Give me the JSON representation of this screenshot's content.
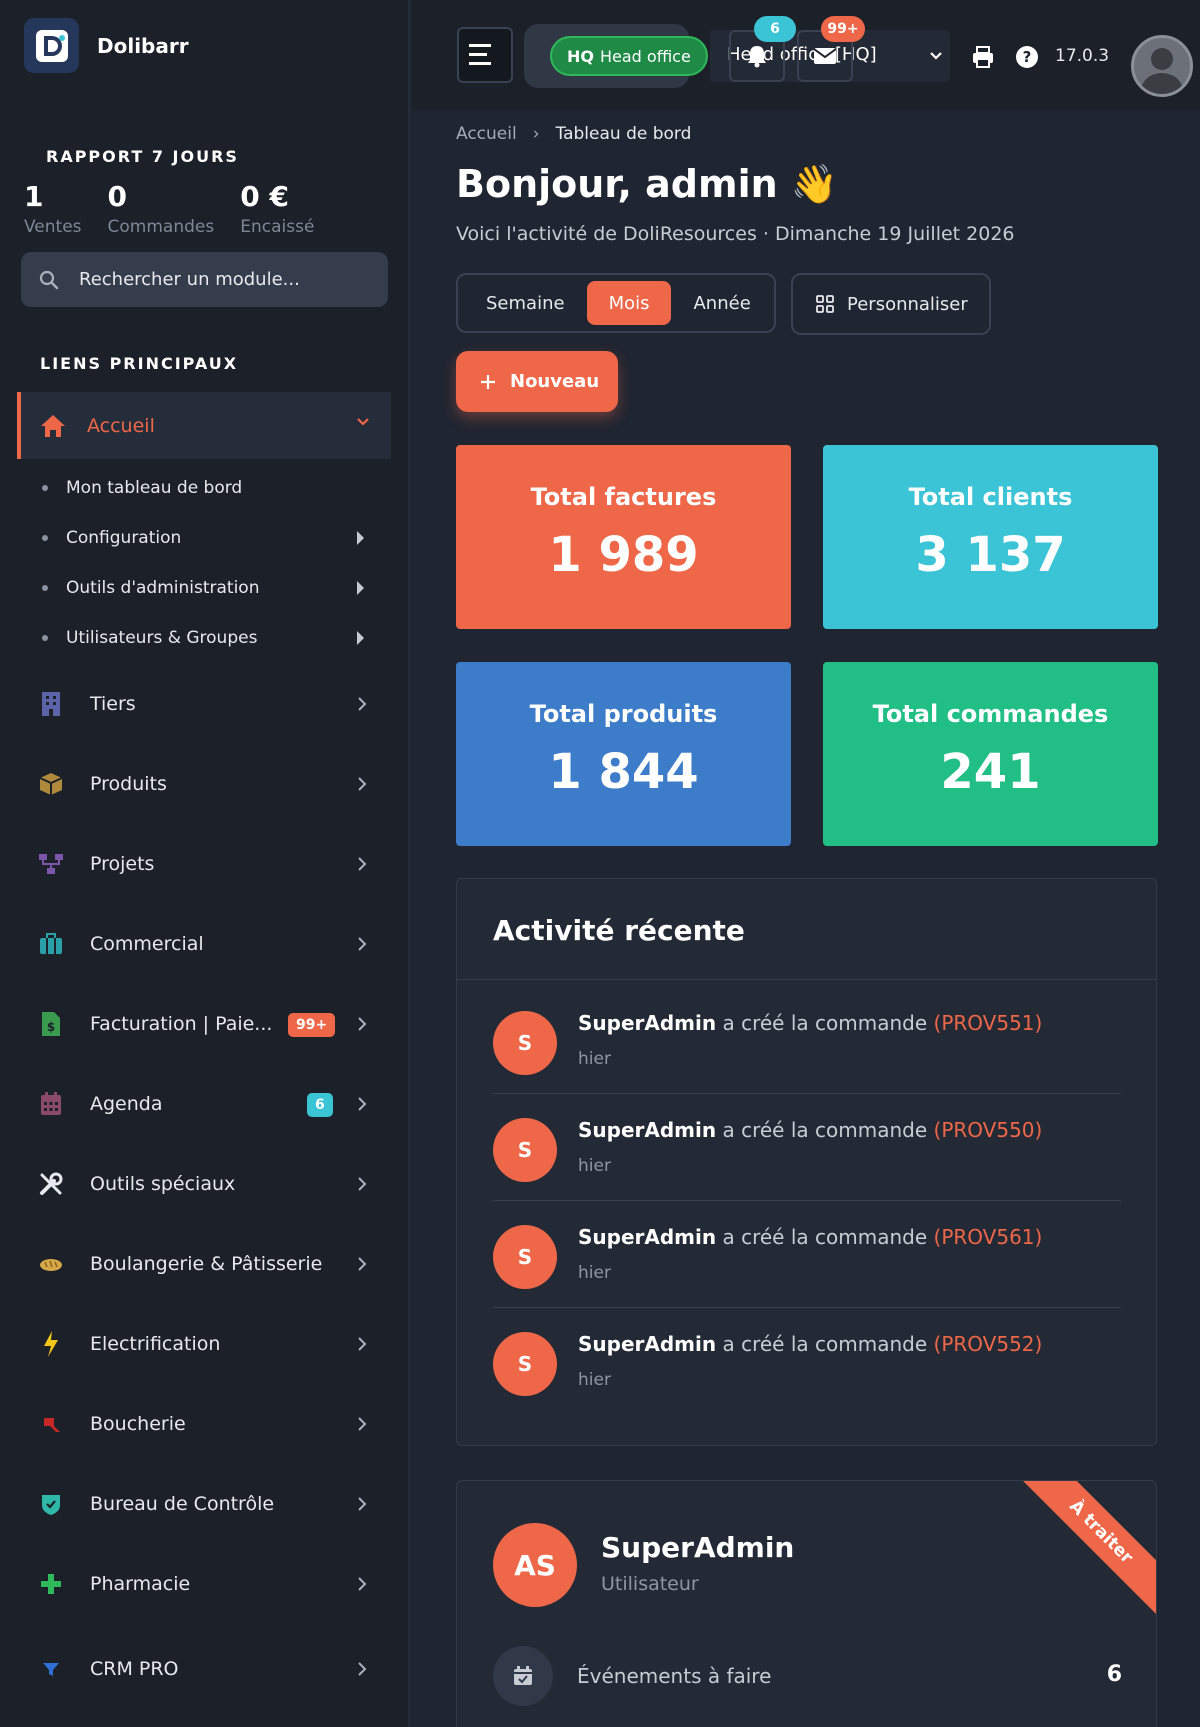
{
  "brand": {
    "name": "Dolibarr"
  },
  "report": {
    "title": "RAPPORT 7 JOURS",
    "stats": [
      {
        "value": "1",
        "label": "Ventes"
      },
      {
        "value": "0",
        "label": "Commandes"
      },
      {
        "value": "0 €",
        "label": "Encaissé"
      }
    ]
  },
  "search": {
    "placeholder": "Rechercher un module..."
  },
  "sidebar": {
    "section_title": "LIENS PRINCIPAUX",
    "active": {
      "label": "Accueil",
      "icon": "home-icon"
    },
    "subitems": [
      {
        "label": "Mon tableau de bord",
        "has_arrow": false
      },
      {
        "label": "Configuration",
        "has_arrow": true
      },
      {
        "label": "Outils d'administration",
        "has_arrow": true
      },
      {
        "label": "Utilisateurs & Groupes",
        "has_arrow": true
      }
    ],
    "items": [
      {
        "label": "Tiers",
        "icon": "building-icon",
        "color": "#5b64a8"
      },
      {
        "label": "Produits",
        "icon": "box-icon",
        "color": "#b08a3c"
      },
      {
        "label": "Projets",
        "icon": "sitemap-icon",
        "color": "#7a57a8"
      },
      {
        "label": "Commercial",
        "icon": "briefcase-icon",
        "color": "#2aa0a8"
      },
      {
        "label": "Facturation | Paie...",
        "icon": "invoice-icon",
        "color": "#3a9b4f",
        "badge": "99+",
        "badge_color": "#ee6748"
      },
      {
        "label": "Agenda",
        "icon": "calendar-icon",
        "color": "#8a4a6a",
        "badge": "6",
        "badge_color": "#3bc3d6"
      },
      {
        "label": "Outils spéciaux",
        "icon": "tools-icon",
        "color": "#e6e9ee"
      },
      {
        "label": "Boulangerie & Pâtisserie",
        "icon": "bread-icon",
        "color": "#d6a84a"
      },
      {
        "label": "Electrification",
        "icon": "bolt-icon",
        "color": "#f0c419"
      },
      {
        "label": "Boucherie",
        "icon": "meat-icon",
        "color": "#c62828"
      },
      {
        "label": "Bureau de Contrôle",
        "icon": "shield-check-icon",
        "color": "#2fb8a8"
      },
      {
        "label": "Pharmacie",
        "icon": "cross-icon",
        "color": "#2fb85c"
      },
      {
        "label": "CRM PRO",
        "icon": "funnel-icon",
        "color": "#2f6fd6"
      }
    ]
  },
  "topbar": {
    "entity_code": "HQ",
    "entity_name": "Head office",
    "select_text": "Head office [HQ]",
    "notif_count": "6",
    "mail_count": "99+",
    "version": "17.0.3"
  },
  "breadcrumb": {
    "home": "Accueil",
    "current": "Tableau de bord"
  },
  "greeting": "Bonjour, admin 👋",
  "subtitle": "Voici l'activité de DoliResources · Dimanche 19 Juillet 2026",
  "period": {
    "options": [
      "Semaine",
      "Mois",
      "Année"
    ],
    "active": "Mois"
  },
  "customize_label": "Personnaliser",
  "new_label": "Nouveau",
  "cards": [
    {
      "title": "Total factures",
      "value": "1 989",
      "color": "#ee6748"
    },
    {
      "title": "Total clients",
      "value": "3 137",
      "color": "#3bc3d6"
    },
    {
      "title": "Total produits",
      "value": "1 844",
      "color": "#3d7cc9"
    },
    {
      "title": "Total commandes",
      "value": "241",
      "color": "#21be85"
    }
  ],
  "activity": {
    "title": "Activité récente",
    "items": [
      {
        "initial": "S",
        "user": "SuperAdmin",
        "action": "a créé la commande",
        "ref": "(PROV551)",
        "time": "hier"
      },
      {
        "initial": "S",
        "user": "SuperAdmin",
        "action": "a créé la commande",
        "ref": "(PROV550)",
        "time": "hier"
      },
      {
        "initial": "S",
        "user": "SuperAdmin",
        "action": "a créé la commande",
        "ref": "(PROV561)",
        "time": "hier"
      },
      {
        "initial": "S",
        "user": "SuperAdmin",
        "action": "a créé la commande",
        "ref": "(PROV552)",
        "time": "hier"
      }
    ]
  },
  "user_card": {
    "initials": "AS",
    "name": "SuperAdmin",
    "role": "Utilisateur",
    "ribbon": "À traiter",
    "events_label": "Événements à faire",
    "events_count": "6"
  }
}
